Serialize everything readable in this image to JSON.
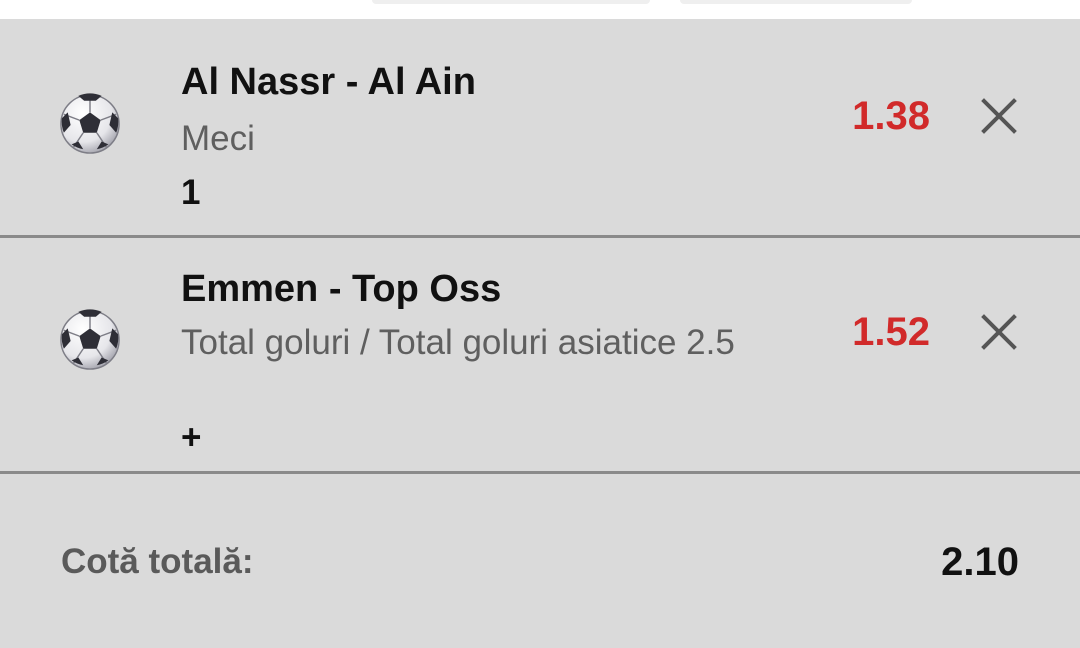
{
  "bets": [
    {
      "event": "Al Nassr - Al Ain",
      "market": "Meci",
      "selection": "1",
      "odds": "1.38",
      "sport_icon": "soccer-ball-icon",
      "remove_icon": "close-icon"
    },
    {
      "event": "Emmen - Top Oss",
      "market": "Total goluri / Total goluri asiatice 2.5",
      "selection": "+",
      "odds": "1.52",
      "sport_icon": "soccer-ball-icon",
      "remove_icon": "close-icon"
    }
  ],
  "total": {
    "label": "Cotă totală:",
    "value": "2.10"
  },
  "colors": {
    "background": "#dadada",
    "odds": "#d12a2a",
    "primary_text": "#111111",
    "secondary_text": "#5f5f5f",
    "divider": "#8a8a8a"
  }
}
